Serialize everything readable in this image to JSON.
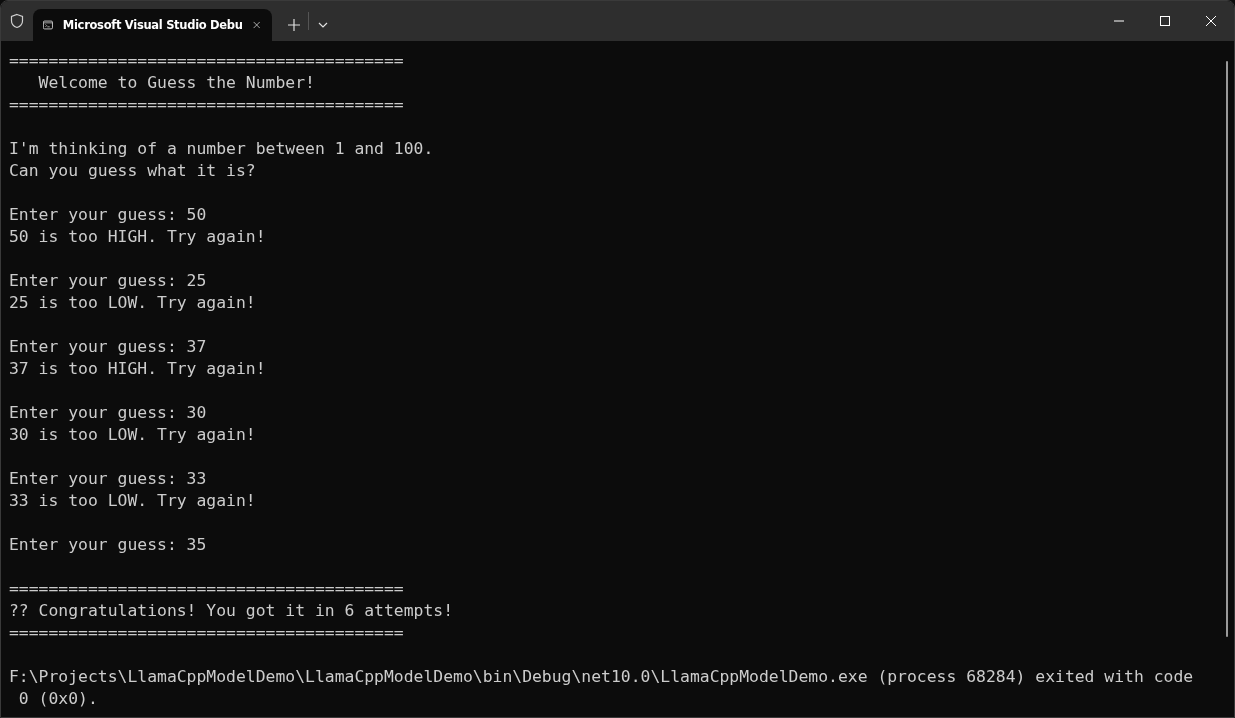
{
  "tab": {
    "title": "Microsoft Visual Studio Debu",
    "selected": true
  },
  "console": {
    "blocks": [
      [
        "========================================",
        "   Welcome to Guess the Number!",
        "========================================"
      ],
      [
        "I'm thinking of a number between 1 and 100.",
        "Can you guess what it is?"
      ],
      [
        "Enter your guess: 50",
        "50 is too HIGH. Try again!"
      ],
      [
        "Enter your guess: 25",
        "25 is too LOW. Try again!"
      ],
      [
        "Enter your guess: 37",
        "37 is too HIGH. Try again!"
      ],
      [
        "Enter your guess: 30",
        "30 is too LOW. Try again!"
      ],
      [
        "Enter your guess: 33",
        "33 is too LOW. Try again!"
      ],
      [
        "Enter your guess: 35"
      ],
      [
        "========================================",
        "?? Congratulations! You got it in 6 attempts!",
        "========================================"
      ],
      [
        "F:\\Projects\\LlamaCppModelDemo\\LlamaCppModelDemo\\bin\\Debug\\net10.0\\LlamaCppModelDemo.exe (process 68284) exited with code",
        " 0 (0x0)."
      ]
    ]
  }
}
